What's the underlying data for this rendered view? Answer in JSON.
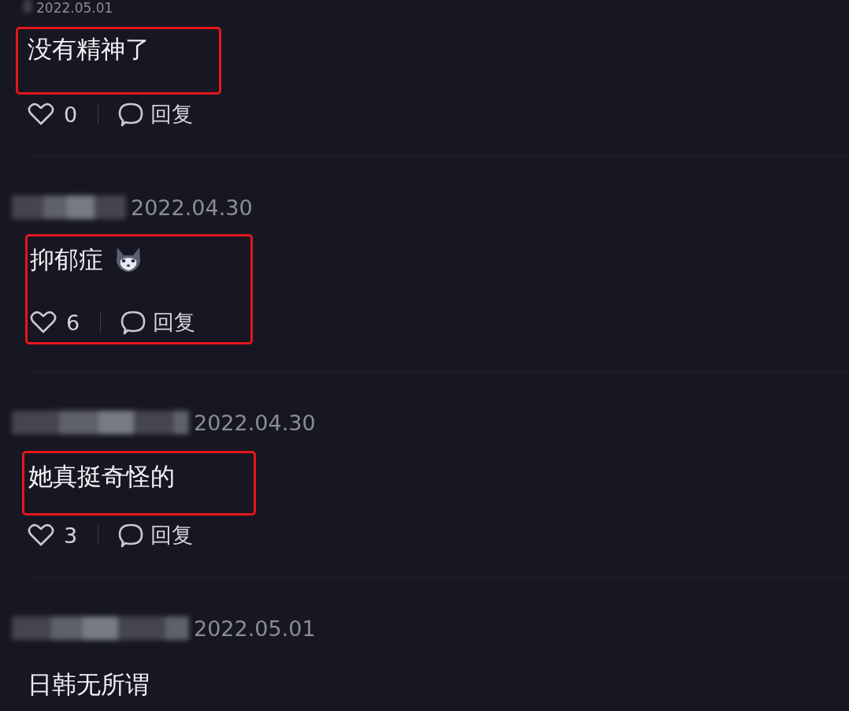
{
  "comments": [
    {
      "date": "2022.05.01",
      "text": "没有精神了",
      "likes": "0",
      "reply": "回复",
      "highlighted": true,
      "actions_in_highlight": false
    },
    {
      "date": "2022.04.30",
      "text": "抑郁症",
      "emoji": true,
      "likes": "6",
      "reply": "回复",
      "highlighted": true,
      "actions_in_highlight": true
    },
    {
      "date": "2022.04.30",
      "text": "她真挺奇怪的",
      "likes": "3",
      "reply": "回复",
      "highlighted": true,
      "actions_in_highlight": false
    },
    {
      "date": "2022.05.01",
      "text": "日韩无所谓",
      "highlighted": false
    }
  ]
}
